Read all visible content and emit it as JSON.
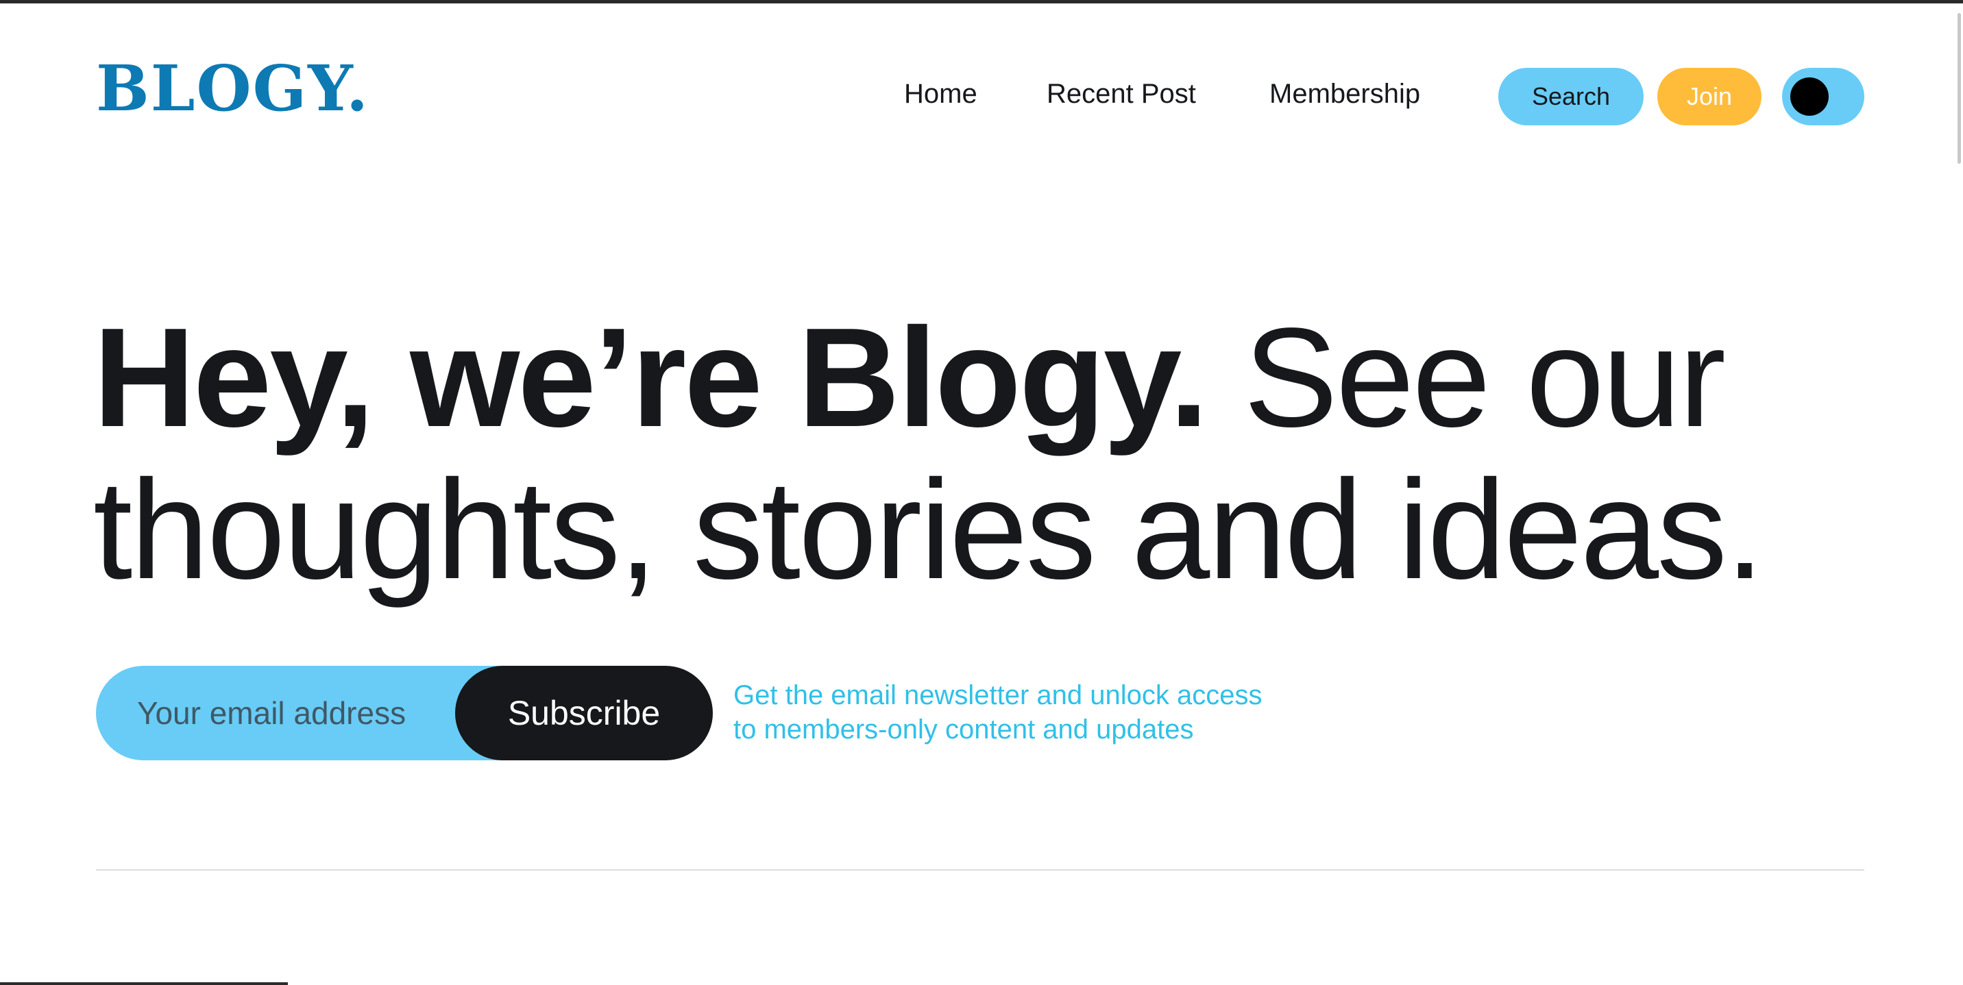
{
  "header": {
    "logo": "BLOGY.",
    "nav": [
      {
        "label": "Home"
      },
      {
        "label": "Recent Post"
      },
      {
        "label": "Membership"
      }
    ],
    "search_label": "Search",
    "join_label": "Join",
    "theme_toggle_icon": "dark-mode-toggle"
  },
  "hero": {
    "strong_text": "Hey, we’re Blogy.",
    "light_text_line1": " See our",
    "light_text_line2": "thoughts, stories and ideas."
  },
  "subscribe": {
    "email_placeholder": "Your email address",
    "button_label": "Subscribe",
    "newsletter_line1": "Get the email newsletter and unlock access",
    "newsletter_line2": "to members-only content and updates"
  },
  "colors": {
    "accent_blue": "#68ccf6",
    "logo_blue": "#0d7ab3",
    "join_yellow": "#ffbc3b",
    "text_dark": "#16181c",
    "newsletter_cyan": "#2fc0e8"
  }
}
